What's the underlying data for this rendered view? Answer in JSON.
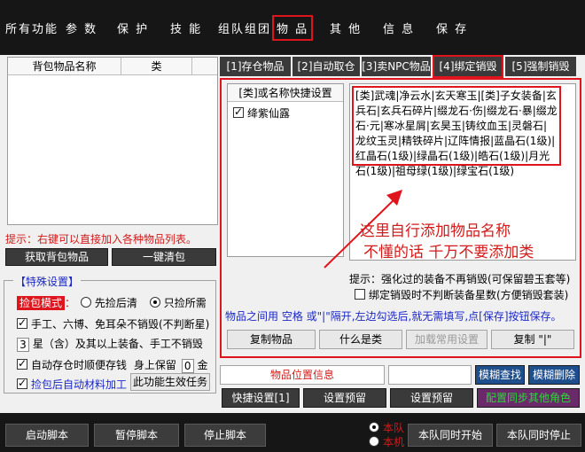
{
  "menu": {
    "items": [
      "所有功能",
      "参 数",
      "保 护",
      "技 能",
      "组队组团",
      "物 品",
      "其 他",
      "信 息",
      "保 存"
    ],
    "active_index": 5
  },
  "left": {
    "grid_headers": [
      "背包物品名称",
      "类"
    ],
    "tip": "提示：右键可以直接加入各种物品列表。",
    "get_bag_button": "获取背包物品",
    "clear_bag_button": "一键清包",
    "group_title": "【特殊设置】",
    "pick_mode_label": "捡包模式",
    "pick_mode_options": [
      "先捡后清",
      "只捡所需"
    ],
    "pick_mode_selected": 1,
    "no_destroy_label": "手工、六博、免耳朵不销毁(不判断星)",
    "star_value": "3",
    "star_label": "星（含）及其以上装备、手工不销毁",
    "auto_store_label": "自动存仓时顺便存钱",
    "keep_label": "身上保留",
    "keep_value": "0",
    "keep_unit": "金",
    "auto_process_label": "捡包后自动材料加工",
    "task_button": "此功能生效任务"
  },
  "tabs": [
    "[1]存仓物品",
    "[2]自动取仓",
    "[3]卖NPC物品",
    "[4]绑定销毁",
    "[5]强制销毁"
  ],
  "active_tab": 3,
  "bind_panel": {
    "list_header": "[类]或名称快捷设置",
    "list_items": [
      {
        "label": "绛紫仙露",
        "checked": true
      }
    ],
    "names_text": "[类]武魂|净云水|玄天寒玉|[类]子女装备|玄兵石|玄兵石碎片|缀龙石·伤|缀龙石·暴|缀龙石·元|寒冰星屑|玄昊玉|铸纹血玉|灵磐石|龙纹玉灵|精铁碎片|辽阵情报|蓝晶石(1级)|红晶石(1级)|绿晶石(1级)|皓石(1级)|月光石(1级)|祖母绿(1级)|绿宝石(1级)",
    "annotation_line1": "这里自行添加物品名称",
    "annotation_line2": "不懂的话 千万不要添加类",
    "hint": "提示：强化过的装备不再销毁(可保留碧玉套等)",
    "star_check_label": "绑定销毁时不判断装备星数(方便销毁套装)",
    "separator_note": "物品之间用 空格 或\"|\"隔开,左边勾选后,就无需填写,点[保存]按钮保存。",
    "buttons": [
      "复制物品",
      "什么是类",
      "加载常用设置",
      "复制 \"|\""
    ]
  },
  "pos_row": {
    "label": "物品位置信息",
    "search_button": "模糊查找",
    "delete_button": "模糊删除"
  },
  "action_row": [
    "快捷设置[1]",
    "设置预留",
    "设置预留",
    "配置同步其他角色"
  ],
  "bottom": {
    "buttons": [
      "启动脚本",
      "暂停脚本",
      "停止脚本"
    ],
    "radios": [
      "本队",
      "本机"
    ],
    "radio_selected": 0,
    "sync_start": "本队同时开始",
    "sync_stop": "本队同时停止"
  },
  "colors": {
    "accent_red": "#e0141c",
    "blue_text": "#1b28c8",
    "green_button": "#2bd63a",
    "green_text_bg": "#5a1a6a"
  }
}
